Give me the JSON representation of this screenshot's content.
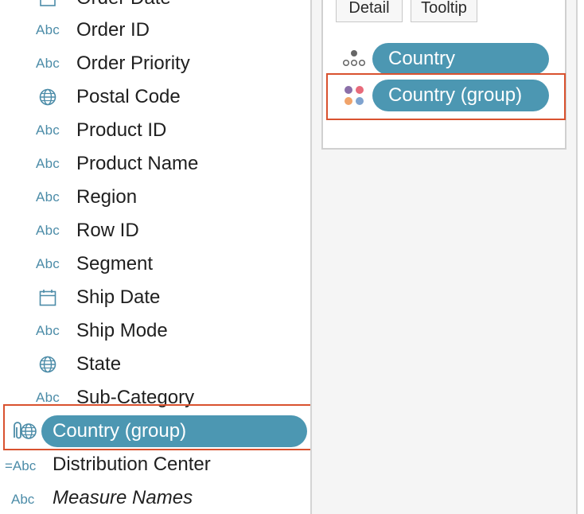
{
  "data_pane": {
    "clipped_top_label": "Order Date",
    "fields": [
      {
        "icon": "Abc",
        "icon_name": "string-type-icon",
        "label": "Order ID"
      },
      {
        "icon": "Abc",
        "icon_name": "string-type-icon",
        "label": "Order Priority"
      },
      {
        "icon": "globe",
        "icon_name": "globe-icon",
        "label": "Postal Code"
      },
      {
        "icon": "Abc",
        "icon_name": "string-type-icon",
        "label": "Product ID"
      },
      {
        "icon": "Abc",
        "icon_name": "string-type-icon",
        "label": "Product Name"
      },
      {
        "icon": "Abc",
        "icon_name": "string-type-icon",
        "label": "Region"
      },
      {
        "icon": "Abc",
        "icon_name": "string-type-icon",
        "label": "Row ID"
      },
      {
        "icon": "Abc",
        "icon_name": "string-type-icon",
        "label": "Segment"
      },
      {
        "icon": "calendar",
        "icon_name": "calendar-icon",
        "label": "Ship Date"
      },
      {
        "icon": "Abc",
        "icon_name": "string-type-icon",
        "label": "Ship Mode"
      },
      {
        "icon": "globe",
        "icon_name": "globe-icon",
        "label": "State"
      },
      {
        "icon": "Abc",
        "icon_name": "string-type-icon",
        "label": "Sub-Category"
      }
    ],
    "group_pill": {
      "label": "Country (group)",
      "icon_name": "paperclip-globe-icon"
    },
    "distribution_center": {
      "icon": "=Abc",
      "label": "Distribution Center"
    },
    "measure_names": {
      "icon": "Abc",
      "label": "Measure Names"
    }
  },
  "marks_card": {
    "buttons": {
      "detail": "Detail",
      "tooltip": "Tooltip"
    },
    "pills": [
      {
        "label": "Country",
        "icon_name": "detail-icon"
      },
      {
        "label": "Country (group)",
        "icon_name": "color-icon"
      }
    ]
  },
  "colors": {
    "pill": "#4c97b2",
    "type_icon": "#4c8ca8",
    "highlight": "#d9522f"
  }
}
